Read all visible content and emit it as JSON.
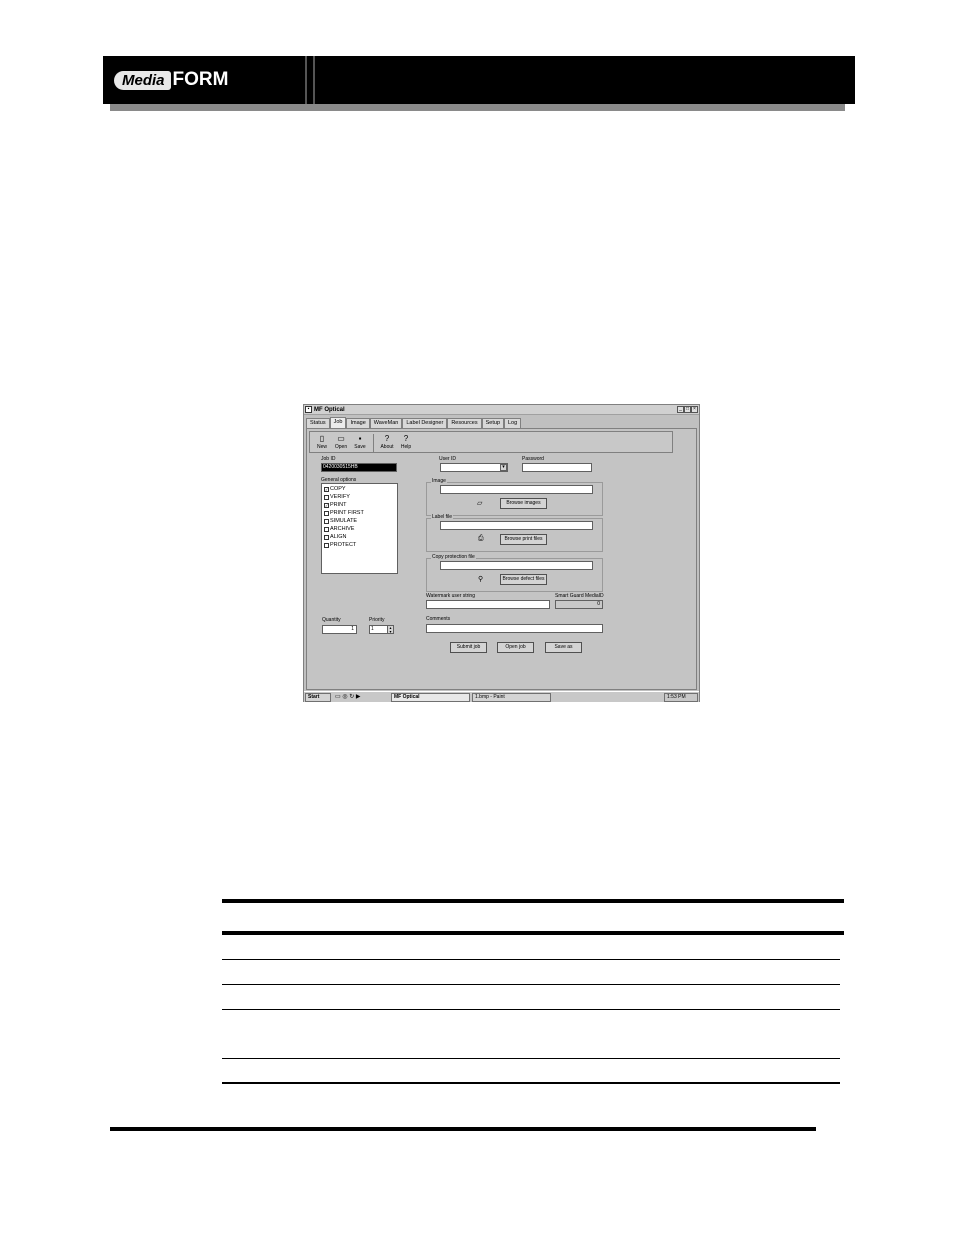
{
  "header": {
    "logo_word1": "Media",
    "logo_word2": "FORM"
  },
  "window": {
    "title": "MF Optical",
    "buttons": {
      "minimize": "_",
      "maximize": "□",
      "close": "×"
    },
    "tabs": [
      "Status",
      "Job",
      "Image",
      "WaveMan",
      "Label Designer",
      "Resources",
      "Setup",
      "Log"
    ],
    "toolbar": [
      "New",
      "Open",
      "Save",
      "About",
      "Help"
    ],
    "job_id_label": "Job ID",
    "job_id_value": "0420030515HB",
    "general_options_label": "General options",
    "options": [
      {
        "label": "COPY",
        "checked": true
      },
      {
        "label": "VERIFY",
        "checked": false
      },
      {
        "label": "PRINT",
        "checked": true
      },
      {
        "label": "PRINT FIRST",
        "checked": false
      },
      {
        "label": "SIMULATE",
        "checked": false
      },
      {
        "label": "ARCHIVE",
        "checked": false
      },
      {
        "label": "ALIGN",
        "checked": false
      },
      {
        "label": "PROTECT",
        "checked": false
      }
    ],
    "quantity_label": "Quantity",
    "quantity_value": "1",
    "priority_label": "Priority",
    "priority_value": "1",
    "user_id_label": "User ID",
    "password_label": "Password",
    "image_label": "Image",
    "browse_images": "Browse images",
    "label_file_label": "Label file",
    "browse_print_files": "Browse print files",
    "copy_protection_label": "Copy protection file",
    "browse_defect_files": "Browse defect files",
    "watermark_label": "Watermark user string",
    "smartguard_label": "Smart Guard MediaID",
    "smartguard_value": "0",
    "comments_label": "Comments",
    "submit_job": "Submit job",
    "open_job": "Open job",
    "save_as": "Save as",
    "taskbar": {
      "start": "Start",
      "task1": "MF Optical",
      "task2": "1.bmp - Paint",
      "clock": "1:53 PM"
    }
  }
}
